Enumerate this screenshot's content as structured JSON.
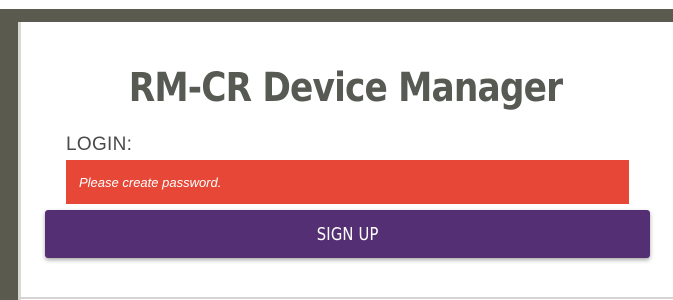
{
  "app": {
    "title": "RM-CR Device Manager"
  },
  "login_form": {
    "label": "LOGIN:",
    "error_message": "Please create password.",
    "signup_label": "SIGN UP"
  },
  "colors": {
    "frame": "#5a5b4e",
    "title_text": "#575a52",
    "error_background": "#e64736",
    "button_background": "#542f73",
    "button_text": "#ffffff"
  }
}
